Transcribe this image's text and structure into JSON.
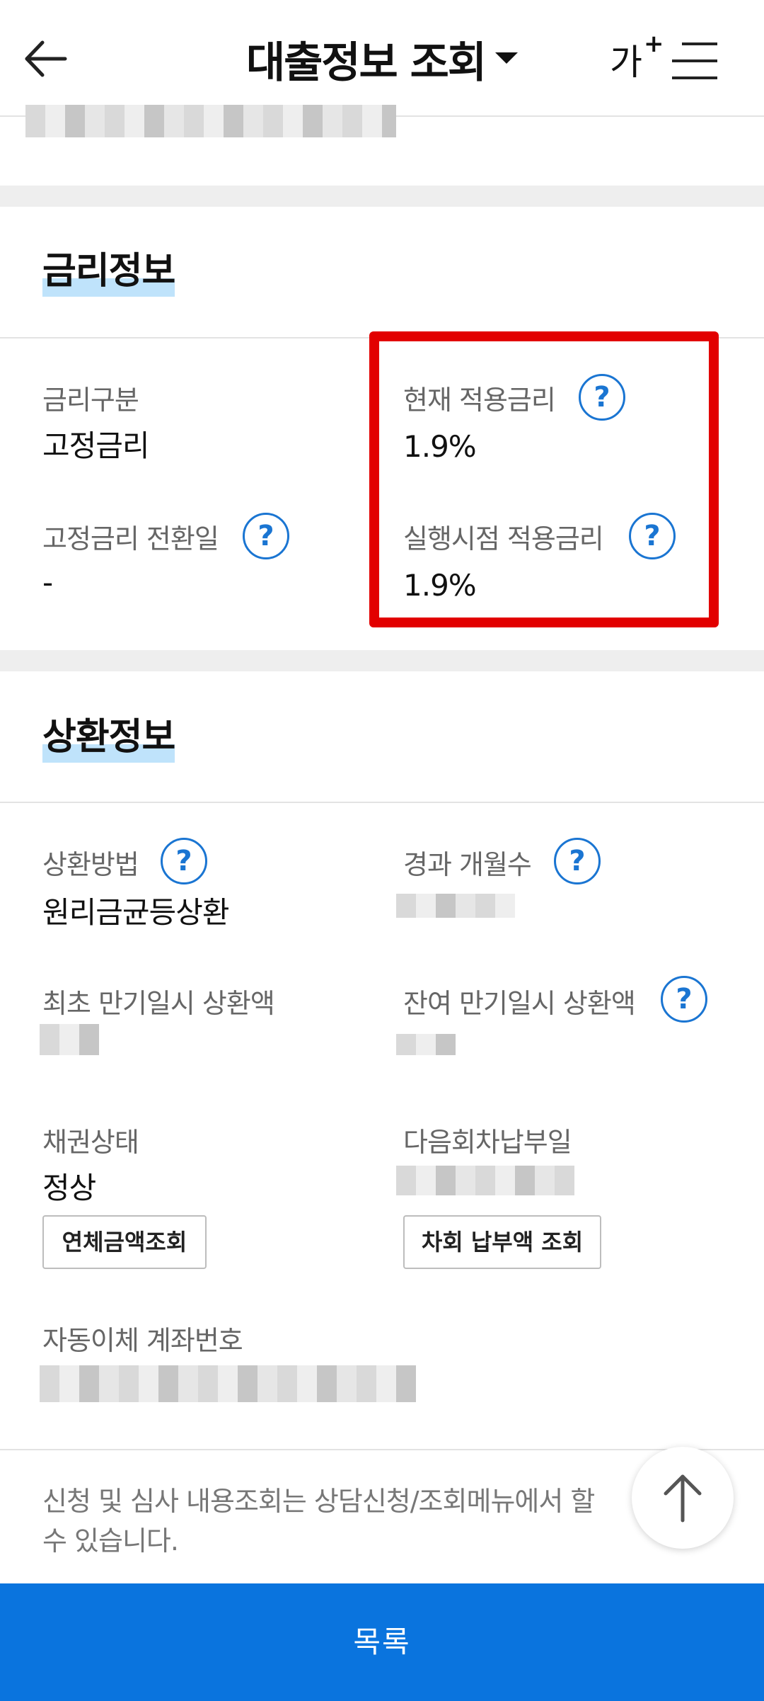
{
  "header": {
    "title": "대출정보 조회",
    "font_size_label": "가",
    "font_size_plus": "+",
    "back_icon": "arrow-left-icon",
    "menu_icon": "hamburger-menu-icon"
  },
  "rate_info": {
    "section_title": "금리정보",
    "rate_type_label": "금리구분",
    "rate_type_value": "고정금리",
    "current_rate_label": "현재 적용금리",
    "current_rate_value": "1.9%",
    "fixed_conversion_label": "고정금리 전환일",
    "fixed_conversion_value": "-",
    "execution_rate_label": "실행시점 적용금리",
    "execution_rate_value": "1.9%"
  },
  "repay_info": {
    "section_title": "상환정보",
    "method_label": "상환방법",
    "method_value": "원리금균등상환",
    "elapsed_months_label": "경과 개월수",
    "initial_maturity_label": "최초 만기일시 상환액",
    "remaining_maturity_label": "잔여 만기일시 상환액",
    "bond_status_label": "채권상태",
    "bond_status_value": "정상",
    "next_payment_date_label": "다음회차납부일",
    "overdue_button": "연체금액조회",
    "next_amount_button": "차회 납부액 조회",
    "auto_transfer_label": "자동이체 계좌번호"
  },
  "help_glyph": "?",
  "notice": "신청 및 심사 내용조회는 상담신청/조회메뉴에서 할 수 있습니다.",
  "bottom_button": "목록",
  "colors": {
    "accent": "#0a74de",
    "help_icon": "#1a75d2",
    "highlight": "#bfe3fb",
    "annotation_box": "#e20000"
  }
}
